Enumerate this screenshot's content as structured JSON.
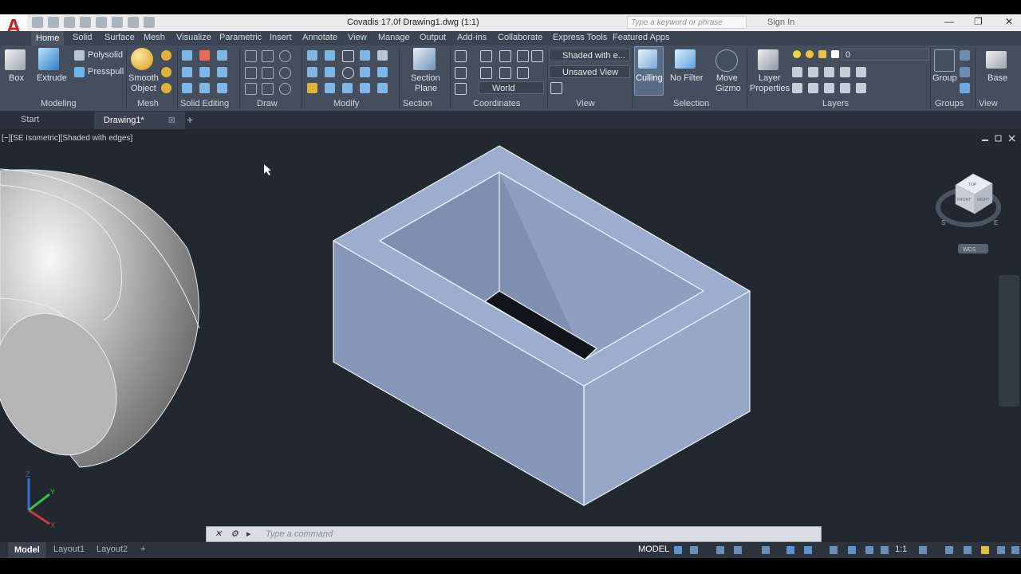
{
  "app": {
    "logo_letter": "A",
    "title": "Covadis 17.0f    Drawing1.dwg (1:1)",
    "search_placeholder": "Type a keyword or phrase",
    "sign_in": "Sign In"
  },
  "window_controls": {
    "minimize": "—",
    "maximize": "❐",
    "close": "✕"
  },
  "ribbon_tabs": [
    "Home",
    "Solid",
    "Surface",
    "Mesh",
    "Visualize",
    "Parametric",
    "Insert",
    "Annotate",
    "View",
    "Manage",
    "Output",
    "Add-ins",
    "Collaborate",
    "Express Tools",
    "Featured Apps"
  ],
  "ribbon": {
    "modeling": {
      "box": "Box",
      "extrude": "Extrude",
      "polysolid": "Polysolid",
      "presspull": "Presspull",
      "panel": "Modeling"
    },
    "mesh": {
      "smooth": "Smooth",
      "object": "Object",
      "panel": "Mesh"
    },
    "solid_editing": {
      "panel": "Solid Editing"
    },
    "draw": {
      "panel": "Draw"
    },
    "modify": {
      "panel": "Modify"
    },
    "section": {
      "section_line1": "Section",
      "section_line2": "Plane",
      "panel": "Section"
    },
    "coordinates": {
      "world": "World",
      "panel": "Coordinates"
    },
    "view": {
      "visual_style": "Shaded with e...",
      "named_view": "Unsaved View",
      "panel": "View"
    },
    "selection": {
      "culling": "Culling",
      "no_filter": "No Filter",
      "move": "Move",
      "gizmo": "Gizmo",
      "panel": "Selection"
    },
    "layers": {
      "layer_line1": "Layer",
      "layer_line2": "Properties",
      "current_layer": "0",
      "panel": "Layers"
    },
    "groups": {
      "group": "Group",
      "panel": "Groups"
    },
    "view2": {
      "base": "Base",
      "panel": "View"
    }
  },
  "doc_tabs": {
    "start": "Start",
    "drawing": "Drawing1*",
    "close": "⊠",
    "add": "+"
  },
  "viewport": {
    "label": "[−][SE Isometric][Shaded with edges]",
    "viewcube": {
      "top": "TOP",
      "front": "FRONT",
      "right": "RIGHT",
      "wcs": "WCS",
      "s": "S",
      "e": "E"
    },
    "ucs": {
      "x": "X",
      "y": "Y",
      "z": "Z"
    }
  },
  "command": {
    "placeholder": "Type a command"
  },
  "status": {
    "model_tab": "Model",
    "layout1": "Layout1",
    "layout2": "Layout2",
    "add": "+",
    "model": "MODEL",
    "scale": "1:1"
  },
  "colors": {
    "ribbon": "#454e5c",
    "viewport": "#212830",
    "solid_face": "#8fa0c0",
    "accent_red": "#d01f1f"
  }
}
